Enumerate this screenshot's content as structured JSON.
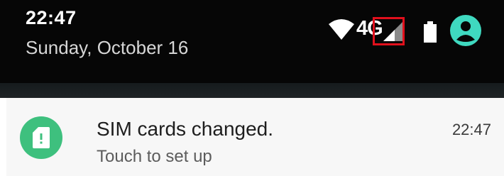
{
  "status_bar": {
    "time": "22:47",
    "date": "Sunday, October 16",
    "network_label": "4G",
    "icons": [
      "wifi-icon",
      "cellular-signal-icon",
      "battery-icon",
      "account-icon"
    ],
    "colors": {
      "highlight": "#e1101c",
      "account": "#3fd9c0"
    }
  },
  "notification": {
    "icon": "sim-card-alert-icon",
    "icon_color": "#3ec07e",
    "title": "SIM cards changed.",
    "time": "22:47",
    "text": "Touch to set up"
  }
}
